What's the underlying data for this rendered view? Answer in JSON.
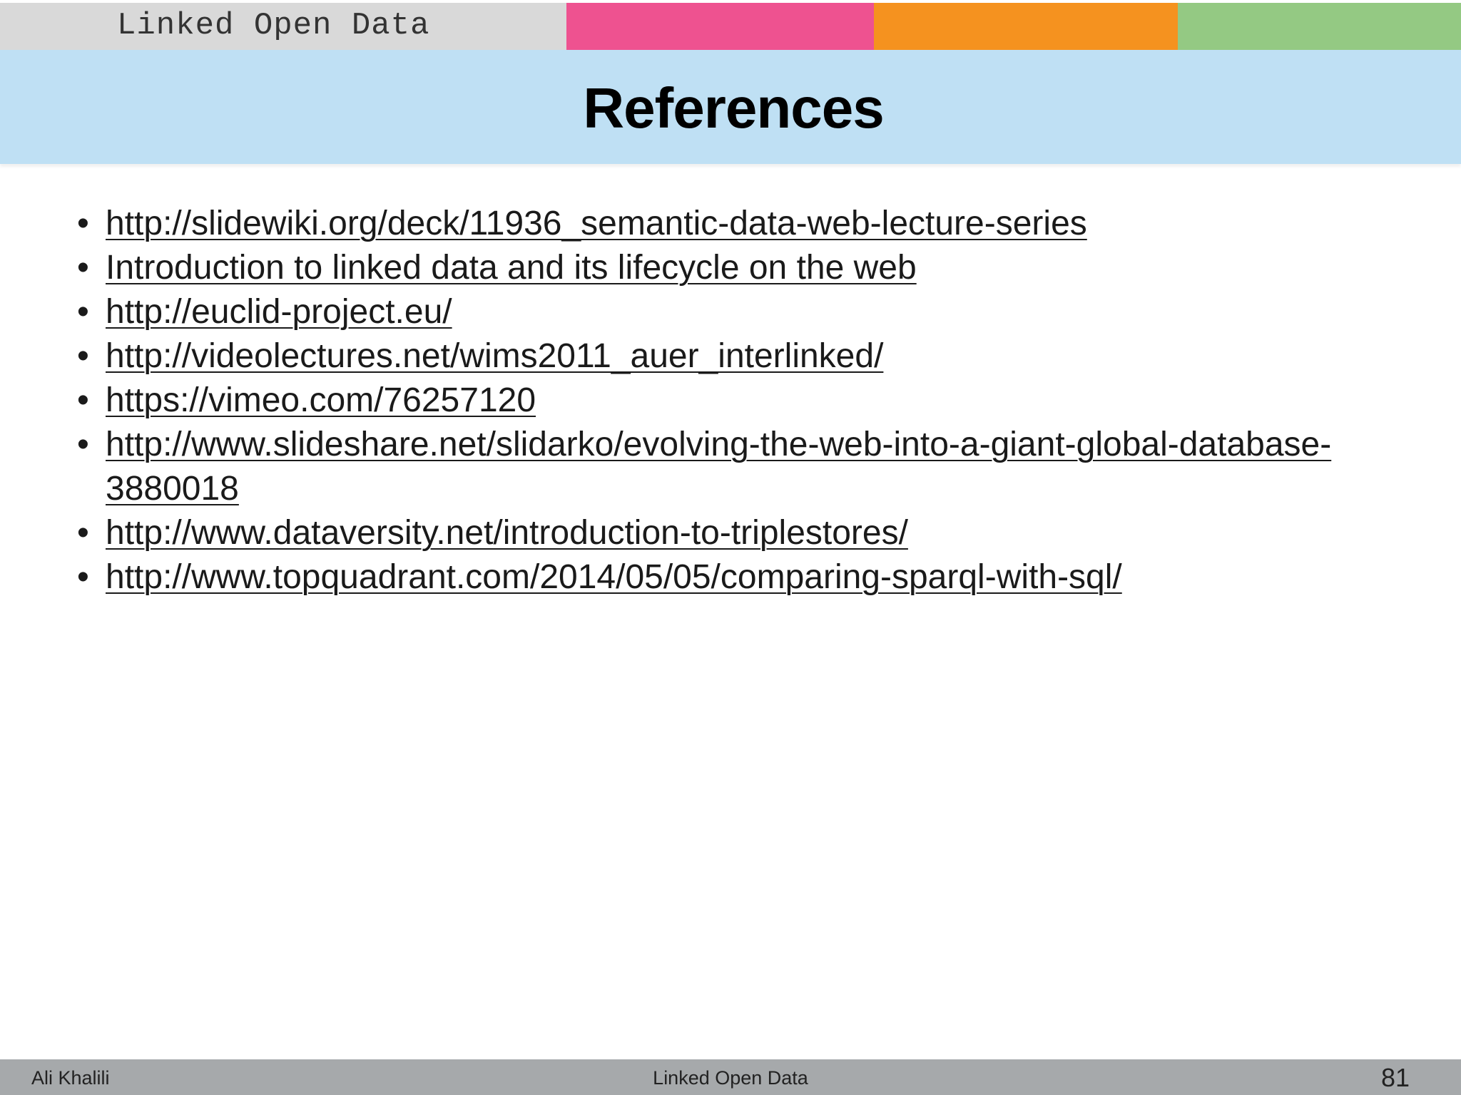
{
  "header": {
    "course_label": "Linked Open Data",
    "colors": {
      "gray": "#d9d9d9",
      "pink": "#ee5290",
      "orange": "#f5921f",
      "green": "#94c983",
      "title_band": "#bfe0f4",
      "footer": "#a6a9ab"
    }
  },
  "title": "References",
  "references": [
    "http://slidewiki.org/deck/11936_semantic-data-web-lecture-series",
    "Introduction to linked data and its lifecycle on the web",
    "http://euclid-project.eu/",
    "http://videolectures.net/wims2011_auer_interlinked/",
    "https://vimeo.com/76257120",
    "http://www.slideshare.net/slidarko/evolving-the-web-into-a-giant-global-database-3880018",
    "http://www.dataversity.net/introduction-to-triplestores/",
    "http://www.topquadrant.com/2014/05/05/comparing-sparql-with-sql/"
  ],
  "footer": {
    "author": "Ali Khalili",
    "center_title": "Linked Open Data",
    "page_number": "81"
  }
}
